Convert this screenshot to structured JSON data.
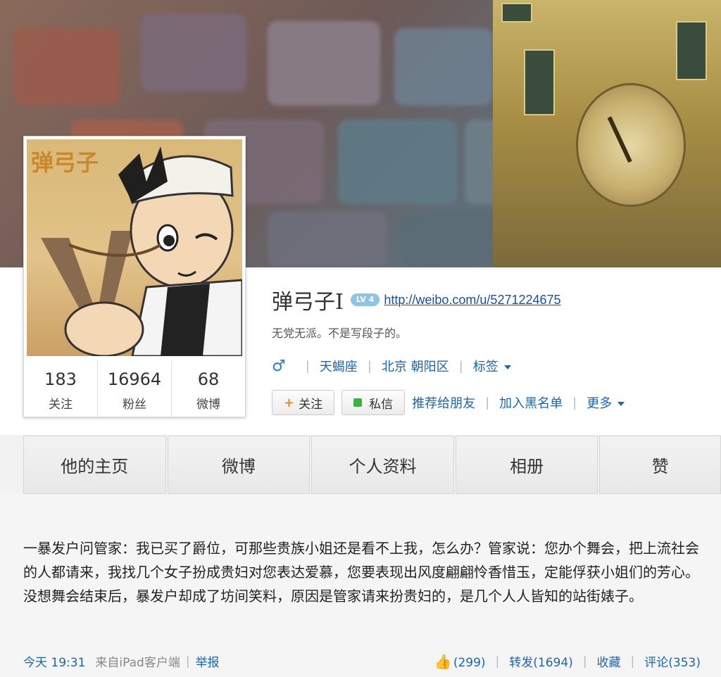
{
  "profile": {
    "name": "弹弓子I",
    "level_badge": "LV 4",
    "url": "http://weibo.com/u/5271224675",
    "bio": "无党无派。不是写段子的。",
    "gender_symbol": "♂",
    "zodiac": "天蝎座",
    "location": "北京 朝阳区",
    "tags_label": "标签",
    "avatar_text": "弹弓子"
  },
  "stats": [
    {
      "value": "183",
      "label": "关注"
    },
    {
      "value": "16964",
      "label": "粉丝"
    },
    {
      "value": "68",
      "label": "微博"
    }
  ],
  "actions": {
    "follow": "关注",
    "message": "私信",
    "recommend": "推荐给朋友",
    "blacklist": "加入黑名单",
    "more": "更多"
  },
  "tabs": [
    "他的主页",
    "微博",
    "个人资料",
    "相册",
    "赞"
  ],
  "post": {
    "text": "一暴发户问管家：我已买了爵位，可那些贵族小姐还是看不上我，怎么办？管家说：您办个舞会，把上流社会的人都请来，我找几个女子扮成贵妇对您表达爱慕，您要表现出风度翩翩怜香惜玉，定能俘获小姐们的芳心。没想舞会结束后，暴发户却成了坊间笑料，原因是管家请来扮贵妇的，是几个人人皆知的站街婊子。",
    "time": "今天 19:31",
    "source": "来自iPad客户端",
    "report": "举报",
    "likes": "(299)",
    "repost": "转发(1694)",
    "favorite": "收藏",
    "comment": "评论(353)"
  },
  "colors": {
    "link": "#1a66b5",
    "accent_orange": "#f08a1c",
    "msg_green": "#3bb43b"
  }
}
